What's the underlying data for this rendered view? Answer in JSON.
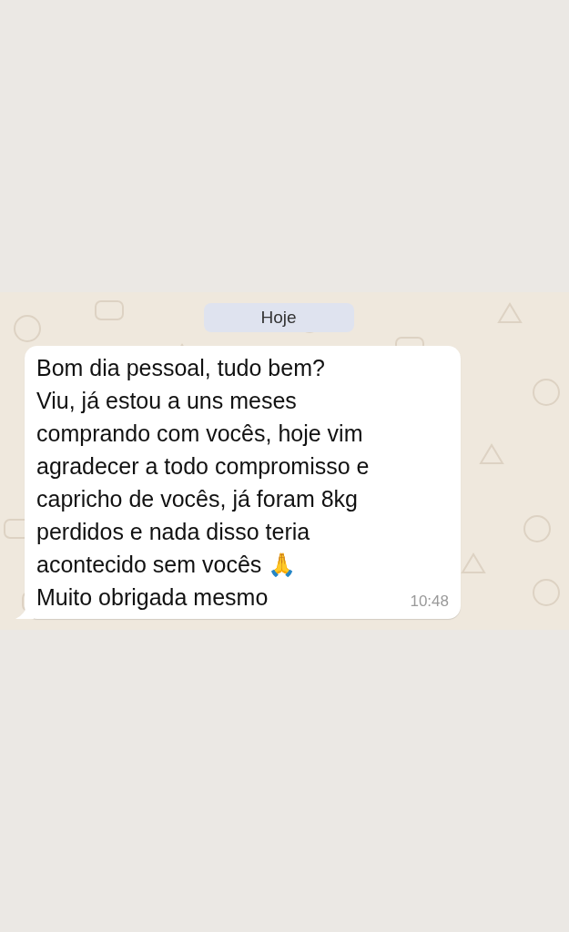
{
  "chat": {
    "date_label": "Hoje",
    "message": {
      "text": "Bom dia pessoal, tudo bem?\nViu, já estou a uns meses\ncomprando com vocês, hoje vim\nagradecer a todo compromisso e\ncapricho de vocês, já foram 8kg\nperdidos e nada disso teria\nacontecido sem vocês 🙏\nMuito obrigada mesmo",
      "time": "10:48"
    }
  }
}
